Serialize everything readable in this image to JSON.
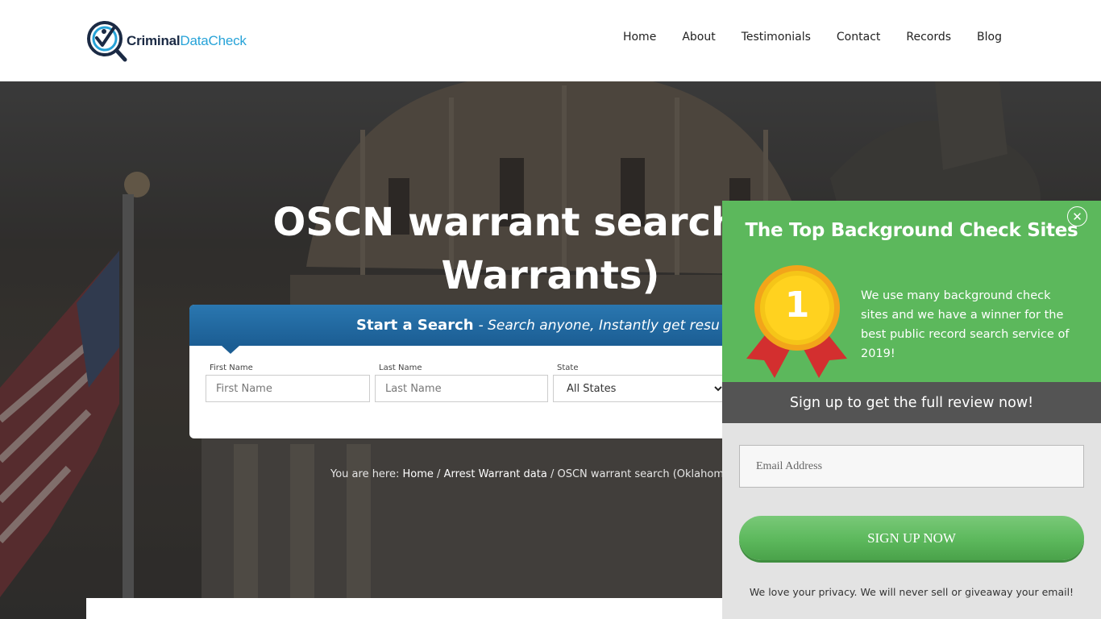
{
  "brand": {
    "part1": "Criminal",
    "part2": "DataCheck"
  },
  "nav": {
    "items": [
      {
        "label": "Home"
      },
      {
        "label": "About"
      },
      {
        "label": "Testimonials"
      },
      {
        "label": "Contact"
      },
      {
        "label": "Records"
      },
      {
        "label": "Blog"
      }
    ]
  },
  "hero": {
    "title_line1": "OSCN warrant search (Ok",
    "title_line2": "Warrants)"
  },
  "search": {
    "heading_strong": "Start a Search",
    "heading_em": "- Search anyone, Instantly get resu",
    "first_name_label": "First Name",
    "first_name_placeholder": "First Name",
    "last_name_label": "Last Name",
    "last_name_placeholder": "Last Name",
    "state_label": "State",
    "state_value": "All States"
  },
  "breadcrumb": {
    "prefix": "You are here:",
    "home": "Home",
    "sep1": "/",
    "category": "Arrest Warrant data",
    "sep2": "/",
    "current": "OSCN warrant search (Oklahoma W"
  },
  "popup": {
    "title": "The Top Background Check Sites",
    "close": "✕",
    "badge_number": "1",
    "description": "We use many background check sites and we have a winner for the best public record search service of 2019!",
    "band_text": "Sign up to get the full review now!",
    "email_placeholder": "Email Address",
    "signup_label": "SIGN UP NOW",
    "privacy_text": "We love your privacy.  We will never sell or giveaway your email!"
  },
  "colors": {
    "brand_dark": "#1b2a44",
    "brand_blue": "#27a3d8",
    "search_band": "#1b5d93",
    "popup_green": "#5cb85c",
    "popup_band": "#545454",
    "medal_gold": "#f5c518",
    "ribbon_red": "#d32f2f"
  }
}
